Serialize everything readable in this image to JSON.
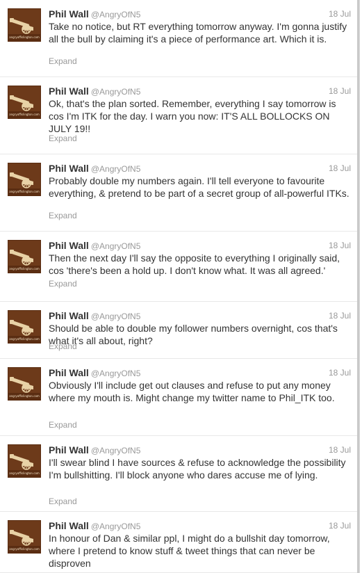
{
  "avatar_caption": "angryoffislington.com",
  "expand_label": "Expand",
  "tweets": [
    {
      "name": "Phil Wall",
      "handle": "@AngryOfN5",
      "date": "18 Jul",
      "text": "Take no notice, but RT everything tomorrow anyway. I'm gonna justify all the bull by claiming it's a piece of performance art. Which it is."
    },
    {
      "name": "Phil Wall",
      "handle": "@AngryOfN5",
      "date": "18 Jul",
      "text": "Ok, that's the plan sorted. Remember, everything I say tomorrow is cos I'm ITK for the day. I warn you now: IT'S ALL BOLLOCKS ON JULY 19!!"
    },
    {
      "name": "Phil Wall",
      "handle": "@AngryOfN5",
      "date": "18 Jul",
      "text": "Probably double my numbers again. I'll tell everyone to favourite everything, & pretend to be part of a secret group of all-powerful ITKs."
    },
    {
      "name": "Phil Wall",
      "handle": "@AngryOfN5",
      "date": "18 Jul",
      "text": "Then the next day I'll say the opposite to everything I originally said, cos 'there's been a hold up. I don't know what. It was all agreed.'"
    },
    {
      "name": "Phil Wall",
      "handle": "@AngryOfN5",
      "date": "18 Jul",
      "text": "Should be able to double my follower numbers overnight, cos that's what it's all about, right?"
    },
    {
      "name": "Phil Wall",
      "handle": "@AngryOfN5",
      "date": "18 Jul",
      "text": "Obviously I'll include get out clauses and refuse to put any money where my mouth is. Might change my twitter name to Phil_ITK too."
    },
    {
      "name": "Phil Wall",
      "handle": "@AngryOfN5",
      "date": "18 Jul",
      "text": "I'll swear blind I have sources & refuse to acknowledge the possibility I'm bullshitting. I'll block anyone who dares accuse me of lying."
    },
    {
      "name": "Phil Wall",
      "handle": "@AngryOfN5",
      "date": "18 Jul",
      "text": "In honour of Dan & similar ppl, I might do a bullshit day tomorrow, where I pretend to know stuff & tweet things that can never be disproven"
    }
  ]
}
